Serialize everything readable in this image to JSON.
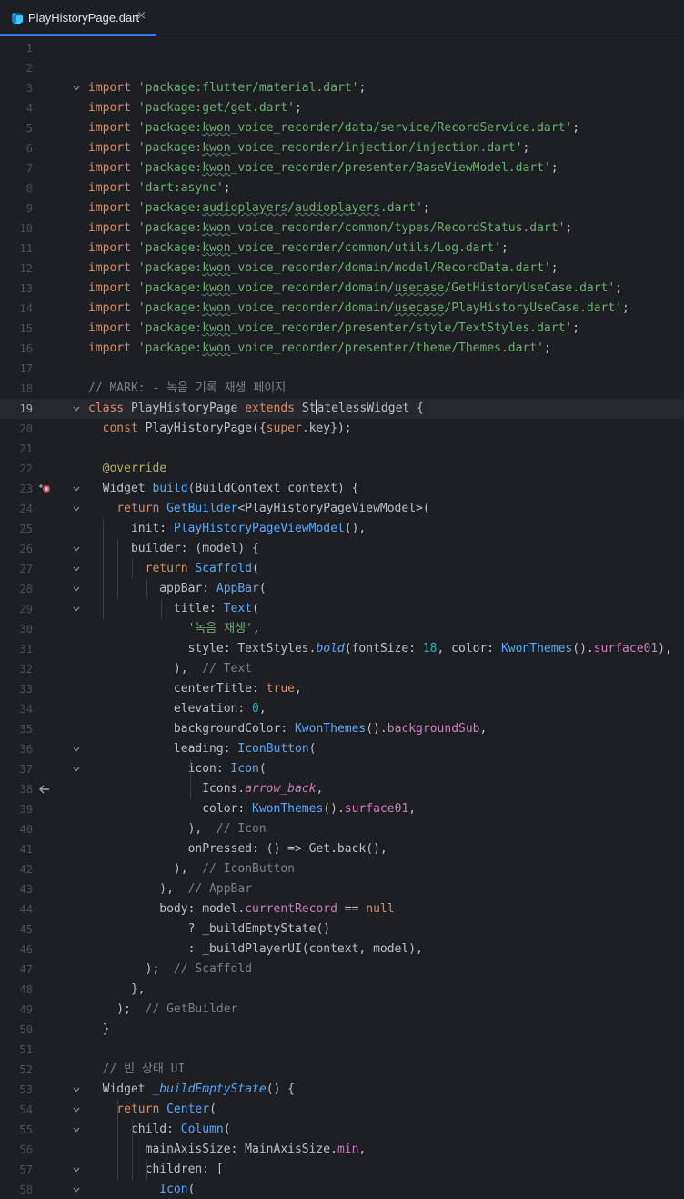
{
  "tab": {
    "title": "PlayHistoryPage.dart",
    "close": "×",
    "icon": "dart-file-icon"
  },
  "colors": {
    "background": "#1e1f22",
    "accent": "#3574f0",
    "keyword": "#cf8e6d",
    "string": "#6aab73",
    "comment": "#7a7e85",
    "function": "#56a8f5",
    "property": "#c77dbb",
    "number": "#2aacb8",
    "annotation": "#b3ae60"
  },
  "editor": {
    "current_line": 19,
    "lines": [
      {
        "n": "1",
        "s": []
      },
      {
        "n": "2",
        "s": []
      },
      {
        "n": "3",
        "fold": "v",
        "s": [
          {
            "t": "import ",
            "c": "kw"
          },
          {
            "t": "'package:flutter/material.dart'",
            "c": "str"
          },
          {
            "t": ";"
          }
        ]
      },
      {
        "n": "4",
        "s": [
          {
            "t": "import ",
            "c": "kw"
          },
          {
            "t": "'package:get/get.dart'",
            "c": "str"
          },
          {
            "t": ";"
          }
        ]
      },
      {
        "n": "5",
        "s": [
          {
            "t": "import ",
            "c": "kw"
          },
          {
            "t": "'package:",
            "c": "str"
          },
          {
            "t": "kwon",
            "c": "str squig"
          },
          {
            "t": "_voice_recorder/data/service/RecordService.dart'",
            "c": "str"
          },
          {
            "t": ";"
          }
        ]
      },
      {
        "n": "6",
        "s": [
          {
            "t": "import ",
            "c": "kw"
          },
          {
            "t": "'package:",
            "c": "str"
          },
          {
            "t": "kwon",
            "c": "str squig"
          },
          {
            "t": "_voice_recorder/injection/injection.dart'",
            "c": "str"
          },
          {
            "t": ";"
          }
        ]
      },
      {
        "n": "7",
        "s": [
          {
            "t": "import ",
            "c": "kw"
          },
          {
            "t": "'package:",
            "c": "str"
          },
          {
            "t": "kwon",
            "c": "str squig"
          },
          {
            "t": "_voice_recorder/presenter/BaseViewModel.dart'",
            "c": "str"
          },
          {
            "t": ";"
          }
        ]
      },
      {
        "n": "8",
        "s": [
          {
            "t": "import ",
            "c": "kw"
          },
          {
            "t": "'dart:async'",
            "c": "str"
          },
          {
            "t": ";"
          }
        ]
      },
      {
        "n": "9",
        "s": [
          {
            "t": "import ",
            "c": "kw"
          },
          {
            "t": "'package:",
            "c": "str"
          },
          {
            "t": "audioplayers",
            "c": "str squig"
          },
          {
            "t": "/",
            "c": "str"
          },
          {
            "t": "audioplayers",
            "c": "str squig"
          },
          {
            "t": ".dart'",
            "c": "str"
          },
          {
            "t": ";"
          }
        ]
      },
      {
        "n": "10",
        "s": [
          {
            "t": "import ",
            "c": "kw"
          },
          {
            "t": "'package:",
            "c": "str"
          },
          {
            "t": "kwon",
            "c": "str squig"
          },
          {
            "t": "_voice_recorder/common/types/RecordStatus.dart'",
            "c": "str"
          },
          {
            "t": ";"
          }
        ]
      },
      {
        "n": "11",
        "s": [
          {
            "t": "import ",
            "c": "kw"
          },
          {
            "t": "'package:",
            "c": "str"
          },
          {
            "t": "kwon",
            "c": "str squig"
          },
          {
            "t": "_voice_recorder/common/utils/Log.dart'",
            "c": "str"
          },
          {
            "t": ";"
          }
        ]
      },
      {
        "n": "12",
        "s": [
          {
            "t": "import ",
            "c": "kw"
          },
          {
            "t": "'package:",
            "c": "str"
          },
          {
            "t": "kwon",
            "c": "str squig"
          },
          {
            "t": "_voice_recorder/domain/model/RecordData.dart'",
            "c": "str"
          },
          {
            "t": ";"
          }
        ]
      },
      {
        "n": "13",
        "s": [
          {
            "t": "import ",
            "c": "kw"
          },
          {
            "t": "'package:",
            "c": "str"
          },
          {
            "t": "kwon",
            "c": "str squig"
          },
          {
            "t": "_voice_recorder/domain/",
            "c": "str"
          },
          {
            "t": "usecase",
            "c": "str squig"
          },
          {
            "t": "/GetHistoryUseCase.dart'",
            "c": "str"
          },
          {
            "t": ";"
          }
        ]
      },
      {
        "n": "14",
        "s": [
          {
            "t": "import ",
            "c": "kw"
          },
          {
            "t": "'package:",
            "c": "str"
          },
          {
            "t": "kwon",
            "c": "str squig"
          },
          {
            "t": "_voice_recorder/domain/",
            "c": "str"
          },
          {
            "t": "usecase",
            "c": "str squig"
          },
          {
            "t": "/PlayHistoryUseCase.dart'",
            "c": "str"
          },
          {
            "t": ";"
          }
        ]
      },
      {
        "n": "15",
        "s": [
          {
            "t": "import ",
            "c": "kw"
          },
          {
            "t": "'package:",
            "c": "str"
          },
          {
            "t": "kwon",
            "c": "str squig"
          },
          {
            "t": "_voice_recorder/presenter/style/TextStyles.dart'",
            "c": "str"
          },
          {
            "t": ";"
          }
        ]
      },
      {
        "n": "16",
        "s": [
          {
            "t": "import ",
            "c": "kw"
          },
          {
            "t": "'package:",
            "c": "str"
          },
          {
            "t": "kwon",
            "c": "str squig"
          },
          {
            "t": "_voice_recorder/presenter/theme/Themes.dart'",
            "c": "str"
          },
          {
            "t": ";"
          }
        ]
      },
      {
        "n": "17",
        "s": []
      },
      {
        "n": "18",
        "s": [
          {
            "t": "// MARK: - 녹음 기록 재생 페이지",
            "c": "cm"
          }
        ]
      },
      {
        "n": "19",
        "fold": "v",
        "s": [
          {
            "t": "class ",
            "c": "kw"
          },
          {
            "t": "PlayHistoryPage "
          },
          {
            "t": "extends ",
            "c": "kw"
          },
          {
            "t": "St"
          },
          {
            "caret": true
          },
          {
            "t": "atelessWidget"
          },
          {
            "t": " {"
          }
        ]
      },
      {
        "n": "20",
        "s": [
          {
            "t": "  const ",
            "c": "kw"
          },
          {
            "t": "PlayHistoryPage({"
          },
          {
            "t": "super",
            "c": "kw"
          },
          {
            "t": ".key});"
          }
        ]
      },
      {
        "n": "21",
        "s": []
      },
      {
        "n": "22",
        "s": [
          {
            "t": "  @override",
            "c": "ann"
          }
        ]
      },
      {
        "n": "23",
        "fold": "v",
        "icon": true,
        "s": [
          {
            "t": "  Widget "
          },
          {
            "t": "build",
            "c": "cls"
          },
          {
            "t": "(BuildContext context) {"
          }
        ]
      },
      {
        "n": "24",
        "fold": "v",
        "s": [
          {
            "t": "    return ",
            "c": "kw"
          },
          {
            "t": "GetBuilder",
            "c": "cls"
          },
          {
            "t": "<PlayHistoryPageViewModel>("
          }
        ]
      },
      {
        "n": "25",
        "s": [
          {
            "t": "      init: "
          },
          {
            "t": "PlayHistoryPageViewModel",
            "c": "cls"
          },
          {
            "t": "(),"
          }
        ]
      },
      {
        "n": "26",
        "fold": "v",
        "s": [
          {
            "t": "      builder: (model) {"
          }
        ]
      },
      {
        "n": "27",
        "fold": "v",
        "s": [
          {
            "t": "        return ",
            "c": "kw"
          },
          {
            "t": "Scaffold",
            "c": "cls"
          },
          {
            "t": "("
          }
        ]
      },
      {
        "n": "28",
        "fold": "v",
        "s": [
          {
            "t": "          appBar: "
          },
          {
            "t": "AppBar",
            "c": "cls"
          },
          {
            "t": "("
          }
        ]
      },
      {
        "n": "29",
        "fold": "v",
        "s": [
          {
            "t": "            title: "
          },
          {
            "t": "Text",
            "c": "cls"
          },
          {
            "t": "("
          }
        ]
      },
      {
        "n": "30",
        "s": [
          {
            "t": "              "
          },
          {
            "t": "'녹음 재생'",
            "c": "str"
          },
          {
            "t": ","
          }
        ]
      },
      {
        "n": "31",
        "s": [
          {
            "t": "              style: TextStyles."
          },
          {
            "t": "bold",
            "c": "cls it"
          },
          {
            "t": "(fontSize: "
          },
          {
            "t": "18",
            "c": "num"
          },
          {
            "t": ", color: "
          },
          {
            "t": "KwonThemes",
            "c": "cls"
          },
          {
            "t": "()."
          },
          {
            "t": "surface01",
            "c": "prop"
          },
          {
            "t": "),"
          }
        ]
      },
      {
        "n": "32",
        "s": [
          {
            "t": "            ),  "
          },
          {
            "t": "// Text",
            "c": "cm"
          }
        ]
      },
      {
        "n": "33",
        "s": [
          {
            "t": "            centerTitle: "
          },
          {
            "t": "true",
            "c": "kw"
          },
          {
            "t": ","
          }
        ]
      },
      {
        "n": "34",
        "s": [
          {
            "t": "            elevation: "
          },
          {
            "t": "0",
            "c": "num"
          },
          {
            "t": ","
          }
        ]
      },
      {
        "n": "35",
        "s": [
          {
            "t": "            backgroundColor: "
          },
          {
            "t": "KwonThemes",
            "c": "cls"
          },
          {
            "t": "()."
          },
          {
            "t": "backgroundSub",
            "c": "prop"
          },
          {
            "t": ","
          }
        ]
      },
      {
        "n": "36",
        "fold": "v",
        "s": [
          {
            "t": "            leading: "
          },
          {
            "t": "IconButton",
            "c": "cls"
          },
          {
            "t": "("
          }
        ]
      },
      {
        "n": "37",
        "fold": "v",
        "s": [
          {
            "t": "              icon: "
          },
          {
            "t": "Icon",
            "c": "cls"
          },
          {
            "t": "("
          }
        ]
      },
      {
        "n": "38",
        "arrow": true,
        "s": [
          {
            "t": "                Icons."
          },
          {
            "t": "arrow_back",
            "c": "prop it"
          },
          {
            "t": ","
          }
        ]
      },
      {
        "n": "39",
        "s": [
          {
            "t": "                color: "
          },
          {
            "t": "KwonThemes",
            "c": "cls"
          },
          {
            "t": "()."
          },
          {
            "t": "surface01",
            "c": "prop"
          },
          {
            "t": ","
          }
        ]
      },
      {
        "n": "40",
        "s": [
          {
            "t": "              ),  "
          },
          {
            "t": "// Icon",
            "c": "cm"
          }
        ]
      },
      {
        "n": "41",
        "s": [
          {
            "t": "              onPressed: () => Get.back(),"
          }
        ]
      },
      {
        "n": "42",
        "s": [
          {
            "t": "            ),  "
          },
          {
            "t": "// IconButton",
            "c": "cm"
          }
        ]
      },
      {
        "n": "43",
        "s": [
          {
            "t": "          ),  "
          },
          {
            "t": "// AppBar",
            "c": "cm"
          }
        ]
      },
      {
        "n": "44",
        "s": [
          {
            "t": "          body: model."
          },
          {
            "t": "currentRecord",
            "c": "prop"
          },
          {
            "t": " == "
          },
          {
            "t": "null",
            "c": "kw"
          }
        ]
      },
      {
        "n": "45",
        "s": [
          {
            "t": "              ? _buildEmptyState()"
          }
        ]
      },
      {
        "n": "46",
        "s": [
          {
            "t": "              : _buildPlayerUI(context, model),"
          }
        ]
      },
      {
        "n": "47",
        "s": [
          {
            "t": "        );  "
          },
          {
            "t": "// Scaffold",
            "c": "cm"
          }
        ]
      },
      {
        "n": "48",
        "s": [
          {
            "t": "      },"
          }
        ]
      },
      {
        "n": "49",
        "s": [
          {
            "t": "    );  "
          },
          {
            "t": "// GetBuilder",
            "c": "cm"
          }
        ]
      },
      {
        "n": "50",
        "s": [
          {
            "t": "  }"
          }
        ]
      },
      {
        "n": "51",
        "s": []
      },
      {
        "n": "52",
        "s": [
          {
            "t": "  // 빈 상태 UI",
            "c": "cm"
          }
        ]
      },
      {
        "n": "53",
        "fold": "v",
        "s": [
          {
            "t": "  Widget "
          },
          {
            "t": "_buildEmptyState",
            "c": "cls it"
          },
          {
            "t": "() {"
          }
        ]
      },
      {
        "n": "54",
        "fold": "v",
        "s": [
          {
            "t": "    return ",
            "c": "kw"
          },
          {
            "t": "Center",
            "c": "cls"
          },
          {
            "t": "("
          }
        ]
      },
      {
        "n": "55",
        "fold": "v",
        "s": [
          {
            "t": "      child: "
          },
          {
            "t": "Column",
            "c": "cls"
          },
          {
            "t": "("
          }
        ]
      },
      {
        "n": "56",
        "s": [
          {
            "t": "        mainAxisSize: MainAxisSize."
          },
          {
            "t": "min",
            "c": "prop"
          },
          {
            "t": ","
          }
        ]
      },
      {
        "n": "57",
        "fold": "v",
        "s": [
          {
            "t": "        children: ["
          }
        ]
      },
      {
        "n": "58",
        "fold": "v",
        "s": [
          {
            "t": "          "
          },
          {
            "t": "Icon",
            "c": "cls"
          },
          {
            "t": "("
          }
        ]
      }
    ]
  }
}
